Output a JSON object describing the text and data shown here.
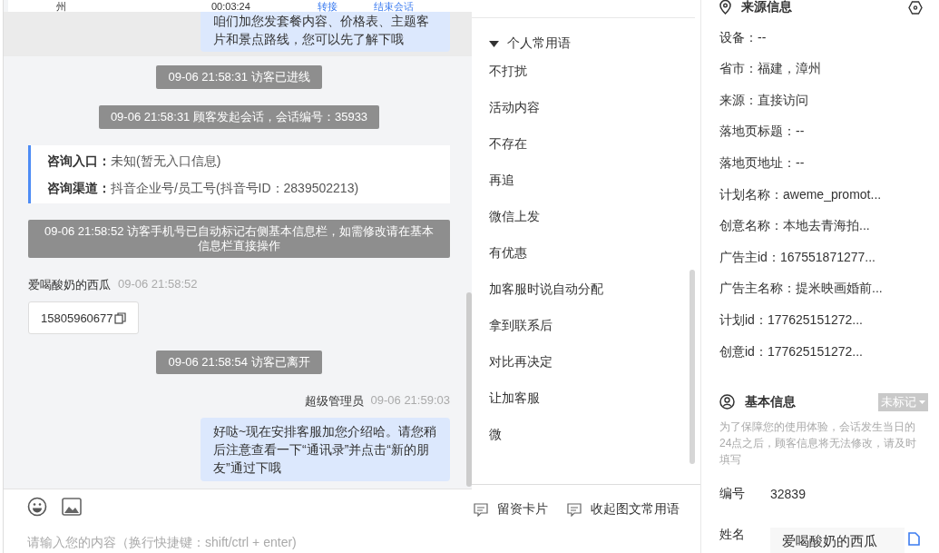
{
  "top_bar": {
    "cells": [
      {
        "text": "州",
        "kind": "plain"
      },
      {
        "text": "00:03:24",
        "kind": "plain"
      },
      {
        "text": "转接",
        "kind": "link"
      },
      {
        "text": "结束会话",
        "kind": "link"
      }
    ]
  },
  "messages": [
    {
      "kind": "cut_bubble",
      "text": "咱们加您发套餐内容、价格表、主题客片和景点路线，您可以先了解下哦"
    },
    {
      "kind": "system",
      "text": "09-06 21:58:31 访客已进线"
    },
    {
      "kind": "system",
      "text": "09-06 21:58:31 顾客发起会话，会话编号：35933"
    },
    {
      "kind": "info_card",
      "rows": [
        {
          "label": "咨询入口：",
          "value": "未知(暂无入口信息)"
        },
        {
          "label": "咨询渠道：",
          "value": "抖音企业号/员工号(抖音号ID：2839502213)"
        }
      ]
    },
    {
      "kind": "system",
      "text": "09-06 21:58:52 访客手机号已自动标记右侧基本信息栏，如需修改请在基本信息栏直接操作"
    },
    {
      "kind": "visitor",
      "sender": "爱喝酸奶的西瓜",
      "time": "09-06 21:58:52",
      "text": "15805960677"
    },
    {
      "kind": "system",
      "text": "09-06 21:58:54 访客已离开"
    },
    {
      "kind": "agent",
      "sender": "超级管理员",
      "time": "09-06 21:59:03",
      "text": "好哒~现在安排客服加您介绍哈。请您稍后注意查看一下“通讯录”并点击“新的朋友”通过下哦"
    }
  ],
  "input": {
    "placeholder": "请输入您的内容（换行快捷键：shift/ctrl + enter)"
  },
  "phrases": {
    "title": "个人常用语",
    "expanded": true,
    "items": [
      "不打扰",
      "活动内容",
      "不存在",
      "再追",
      "微信上发",
      "有优惠",
      "加客服时说自动分配",
      "拿到联系后",
      "对比再决定",
      "让加客服",
      "微"
    ],
    "actions": [
      "留资卡片",
      "收起图文常用语"
    ]
  },
  "source_info": {
    "title": "来源信息",
    "fields": [
      "设备：--",
      "省市：福建，漳州",
      "来源：直接访问",
      "落地页标题：--",
      "落地页地址：--",
      "计划名称：aweme_promot...",
      "创意名称：本地去青海拍...",
      "广告主id：167551871277...",
      "广告主名称：提米映画婚前...",
      "计划id：177625151272...",
      "创意id：177625151272..."
    ]
  },
  "basic_info": {
    "title": "基本信息",
    "tag": "未标记",
    "notice": "为了保障您的使用体验，会话发生当日的24点之后，顾客信息将无法修改，请及时填写",
    "fields": [
      {
        "kind": "text",
        "label": "编号",
        "value": "32839"
      },
      {
        "kind": "input",
        "label": "姓名",
        "value": "爱喝酸奶的西瓜"
      }
    ]
  }
}
